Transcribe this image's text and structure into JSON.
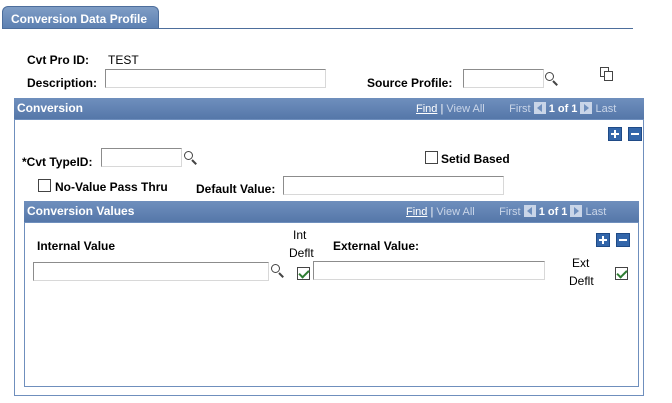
{
  "tab": {
    "label": "Conversion Data Profile"
  },
  "header": {
    "cvt_pro_id_label": "Cvt Pro ID:",
    "cvt_pro_id_value": "TEST",
    "description_label": "Description:",
    "description_value": "",
    "source_profile_label": "Source Profile:",
    "source_profile_value": ""
  },
  "conversion": {
    "title": "Conversion",
    "nav": {
      "find": "Find",
      "sep": "|",
      "view_all": "View All",
      "first": "First",
      "position": "1 of 1",
      "last": "Last"
    },
    "cvt_typeid_label": "*Cvt TypeID:",
    "cvt_typeid_value": "",
    "setid_based_label": "Setid Based",
    "setid_based_checked": false,
    "no_value_pass_thru_label": "No-Value Pass Thru",
    "no_value_pass_thru_checked": false,
    "default_value_label": "Default Value:",
    "default_value_value": ""
  },
  "conversion_values": {
    "title": "Conversion Values",
    "nav": {
      "find": "Find",
      "sep": "|",
      "view_all": "View All",
      "first": "First",
      "position": "1 of 1",
      "last": "Last"
    },
    "internal_value_label": "Internal Value",
    "internal_value_value": "",
    "int_deflt_label_1": "Int",
    "int_deflt_label_2": "Deflt",
    "int_deflt_checked": true,
    "external_value_label": "External Value:",
    "external_value_value": "",
    "ext_deflt_label_1": "Ext",
    "ext_deflt_label_2": "Deflt",
    "ext_deflt_checked": true
  },
  "icons": {
    "lookup": "magnifier-icon",
    "copy": "copy-icon",
    "add_row": "plus-icon",
    "delete_row": "minus-icon",
    "prev": "arrow-left-icon",
    "next": "arrow-right-icon"
  },
  "colors": {
    "accent": "#5b7fb1",
    "button": "#3366aa",
    "check": "#2e7d32"
  }
}
